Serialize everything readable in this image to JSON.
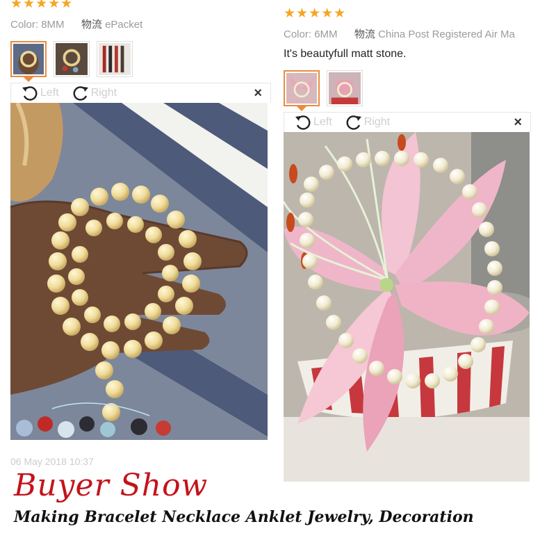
{
  "reviews": [
    {
      "stars": "★★★★★",
      "color_label": "Color:",
      "color_value": "8MM",
      "shipping_label": "物流",
      "shipping_value": "ePacket",
      "thumbnails": [
        "bracelet-in-hand-thumbnail",
        "bracelet-on-cloth-thumbnail",
        "beads-strands-thumbnail"
      ],
      "active_thumbnail": 0,
      "rotate_left": "Left",
      "rotate_right": "Right",
      "close": "×",
      "date": "06 May 2018 10:37"
    },
    {
      "stars": "★★★★★",
      "color_label": "Color:",
      "color_value": "6MM",
      "shipping_label": "物流",
      "shipping_value": "China Post Registered Air Ma",
      "comment": "It's beautyfull matt stone.",
      "thumbnails": [
        "bracelet-on-lily-thumbnail",
        "bracelet-on-flower-thumbnail"
      ],
      "active_thumbnail": 0,
      "rotate_left": "Left",
      "rotate_right": "Right",
      "close": "×"
    }
  ],
  "banner": {
    "title": "Buyer Show",
    "subtitle": "Making Bracelet Necklace Anklet Jewelry, Decoration"
  },
  "colors": {
    "star": "#f5a623",
    "accent": "#e98c3d",
    "banner_title": "#c4131b"
  }
}
